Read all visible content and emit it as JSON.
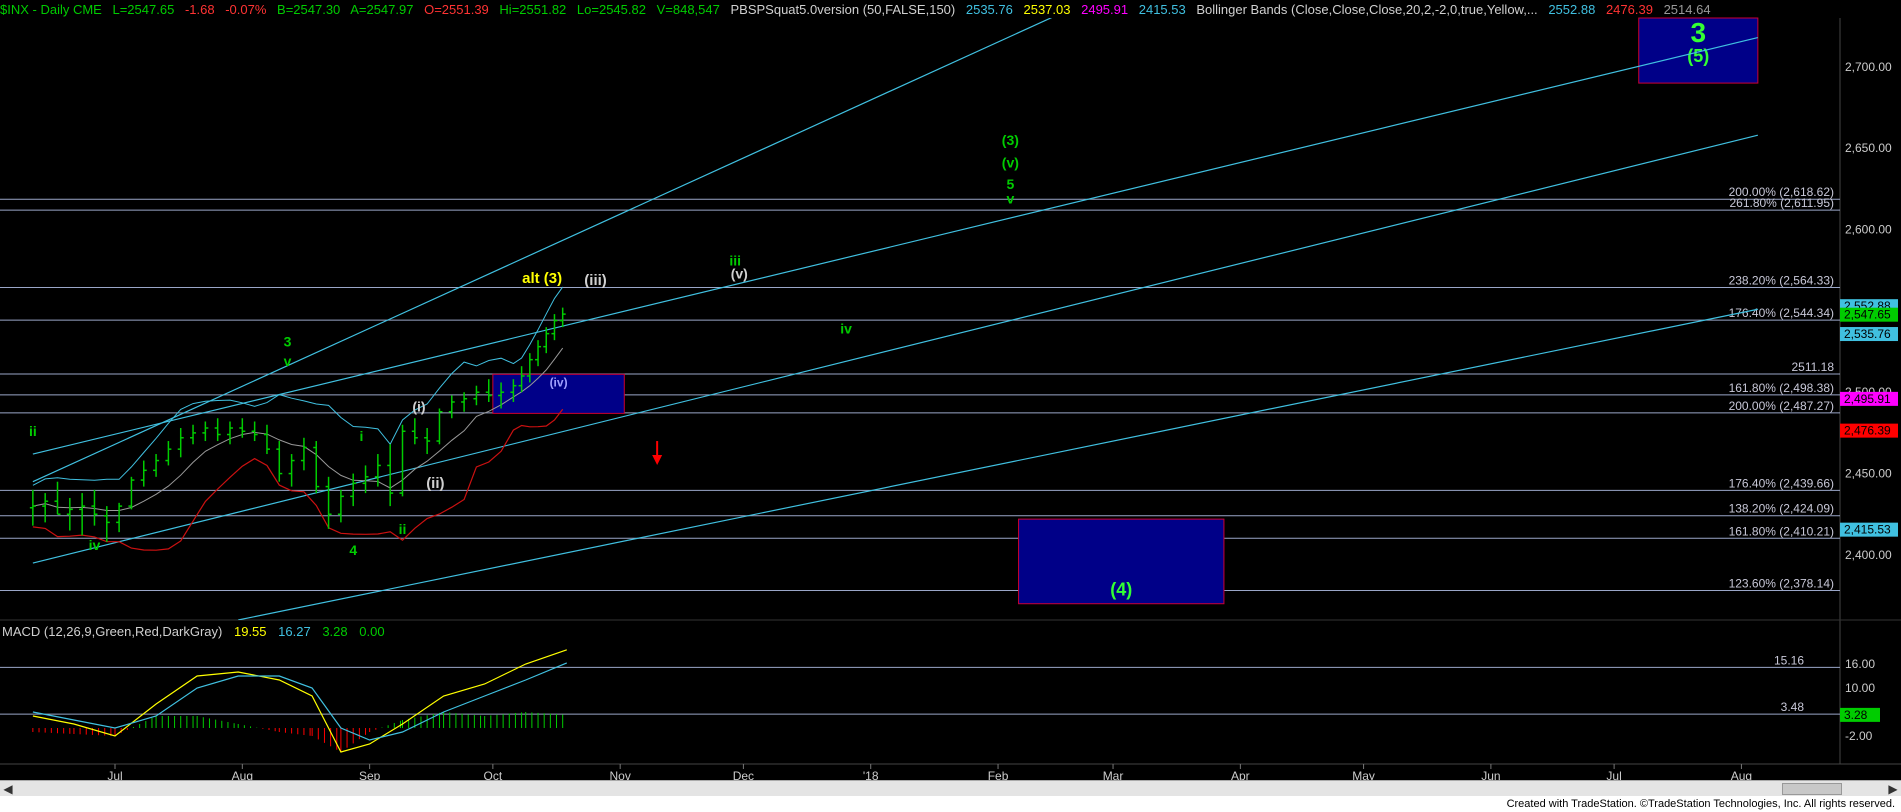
{
  "header": {
    "symbol": "$INX - Daily  CME",
    "last": "L=2547.65",
    "change": "-1.68",
    "change_pct": "-0.07%",
    "bid": "B=2547.30",
    "ask": "A=2547.97",
    "open": "O=2551.39",
    "high": "Hi=2551.82",
    "low": "Lo=2545.82",
    "volume": "V=848,547",
    "study1_name": "PBSPSquat5.0version (50,FALSE,150)",
    "study1_values": [
      "2535.76",
      "2537.03",
      "2495.91",
      "2415.53"
    ],
    "study2_name": "Bollinger Bands (Close,Close,Close,20,2,-2,0,true,Yellow,...",
    "study2_values": [
      "2552.88",
      "2476.39",
      "2514.64"
    ]
  },
  "macd_header": {
    "name": "MACD (12,26,9,Green,Red,DarkGray)",
    "values": [
      "19.55",
      "16.27",
      "3.28",
      "0.00"
    ]
  },
  "colors": {
    "background": "#000000",
    "green": "#00cc00",
    "bright_green": "#33ff33",
    "yellow": "#ffff00",
    "cyan": "#40c0e0",
    "red": "#ff0000",
    "magenta": "#ff00ff",
    "white": "#d0d0d0",
    "navy_box": "#000088"
  },
  "chart_data": {
    "type": "bar",
    "title": "$INX - Daily",
    "price_axis": {
      "range": [
        2360,
        2730
      ],
      "ticks": [
        "2,700.00",
        "2,650.00",
        "2,600.00",
        "2,500.00",
        "2,450.00",
        "2,400.00"
      ],
      "tick_values": [
        2700,
        2650,
        2600,
        2500,
        2450,
        2400
      ]
    },
    "time_axis": {
      "labels": [
        "Jul",
        "Aug",
        "Sep",
        "Oct",
        "Nov",
        "Dec",
        "'18",
        "Feb",
        "Mar",
        "Apr",
        "May",
        "Jun",
        "Jul",
        "Aug"
      ],
      "label_days": [
        20,
        51,
        82,
        112,
        143,
        173,
        204,
        235,
        263,
        294,
        324,
        355,
        385,
        416
      ]
    },
    "ohlc": [
      {
        "d": 0,
        "o": 2429,
        "h": 2440,
        "l": 2418,
        "c": 2430
      },
      {
        "d": 3,
        "o": 2430,
        "h": 2438,
        "l": 2420,
        "c": 2433
      },
      {
        "d": 6,
        "o": 2433,
        "h": 2445,
        "l": 2425,
        "c": 2425
      },
      {
        "d": 9,
        "o": 2425,
        "h": 2435,
        "l": 2415,
        "c": 2428
      },
      {
        "d": 12,
        "o": 2428,
        "h": 2438,
        "l": 2412,
        "c": 2430
      },
      {
        "d": 15,
        "o": 2430,
        "h": 2440,
        "l": 2418,
        "c": 2425
      },
      {
        "d": 18,
        "o": 2424,
        "h": 2430,
        "l": 2408,
        "c": 2420
      },
      {
        "d": 21,
        "o": 2420,
        "h": 2432,
        "l": 2414,
        "c": 2430
      },
      {
        "d": 24,
        "o": 2430,
        "h": 2448,
        "l": 2428,
        "c": 2446
      },
      {
        "d": 27,
        "o": 2446,
        "h": 2458,
        "l": 2442,
        "c": 2452
      },
      {
        "d": 30,
        "o": 2452,
        "h": 2462,
        "l": 2448,
        "c": 2458
      },
      {
        "d": 33,
        "o": 2458,
        "h": 2470,
        "l": 2455,
        "c": 2465
      },
      {
        "d": 36,
        "o": 2465,
        "h": 2478,
        "l": 2460,
        "c": 2472
      },
      {
        "d": 39,
        "o": 2472,
        "h": 2480,
        "l": 2468,
        "c": 2475
      },
      {
        "d": 42,
        "o": 2475,
        "h": 2482,
        "l": 2470,
        "c": 2478
      },
      {
        "d": 45,
        "o": 2478,
        "h": 2484,
        "l": 2470,
        "c": 2474
      },
      {
        "d": 48,
        "o": 2474,
        "h": 2482,
        "l": 2468,
        "c": 2478
      },
      {
        "d": 51,
        "o": 2478,
        "h": 2484,
        "l": 2472,
        "c": 2476
      },
      {
        "d": 54,
        "o": 2476,
        "h": 2482,
        "l": 2470,
        "c": 2474
      },
      {
        "d": 57,
        "o": 2474,
        "h": 2480,
        "l": 2462,
        "c": 2465
      },
      {
        "d": 60,
        "o": 2465,
        "h": 2470,
        "l": 2445,
        "c": 2450
      },
      {
        "d": 63,
        "o": 2450,
        "h": 2462,
        "l": 2442,
        "c": 2458
      },
      {
        "d": 66,
        "o": 2458,
        "h": 2472,
        "l": 2452,
        "c": 2466
      },
      {
        "d": 69,
        "o": 2466,
        "h": 2470,
        "l": 2438,
        "c": 2442
      },
      {
        "d": 72,
        "o": 2442,
        "h": 2448,
        "l": 2416,
        "c": 2425
      },
      {
        "d": 75,
        "o": 2425,
        "h": 2440,
        "l": 2420,
        "c": 2436
      },
      {
        "d": 78,
        "o": 2436,
        "h": 2450,
        "l": 2430,
        "c": 2444
      },
      {
        "d": 81,
        "o": 2444,
        "h": 2455,
        "l": 2438,
        "c": 2448
      },
      {
        "d": 84,
        "o": 2448,
        "h": 2462,
        "l": 2442,
        "c": 2455
      },
      {
        "d": 87,
        "o": 2455,
        "h": 2468,
        "l": 2430,
        "c": 2438
      },
      {
        "d": 90,
        "o": 2438,
        "h": 2480,
        "l": 2436,
        "c": 2476
      },
      {
        "d": 93,
        "o": 2476,
        "h": 2484,
        "l": 2468,
        "c": 2472
      },
      {
        "d": 96,
        "o": 2472,
        "h": 2478,
        "l": 2462,
        "c": 2470
      },
      {
        "d": 99,
        "o": 2470,
        "h": 2490,
        "l": 2468,
        "c": 2488
      },
      {
        "d": 102,
        "o": 2488,
        "h": 2498,
        "l": 2484,
        "c": 2494
      },
      {
        "d": 105,
        "o": 2494,
        "h": 2500,
        "l": 2488,
        "c": 2496
      },
      {
        "d": 108,
        "o": 2496,
        "h": 2504,
        "l": 2492,
        "c": 2500
      },
      {
        "d": 111,
        "o": 2500,
        "h": 2508,
        "l": 2494,
        "c": 2498
      },
      {
        "d": 114,
        "o": 2498,
        "h": 2506,
        "l": 2490,
        "c": 2500
      },
      {
        "d": 117,
        "o": 2500,
        "h": 2508,
        "l": 2494,
        "c": 2504
      },
      {
        "d": 119,
        "o": 2504,
        "h": 2516,
        "l": 2500,
        "c": 2510
      },
      {
        "d": 121,
        "o": 2510,
        "h": 2524,
        "l": 2506,
        "c": 2520
      },
      {
        "d": 123,
        "o": 2520,
        "h": 2532,
        "l": 2516,
        "c": 2528
      },
      {
        "d": 125,
        "o": 2528,
        "h": 2540,
        "l": 2524,
        "c": 2536
      },
      {
        "d": 127,
        "o": 2536,
        "h": 2548,
        "l": 2532,
        "c": 2544
      },
      {
        "d": 129,
        "o": 2544,
        "h": 2552,
        "l": 2540,
        "c": 2548
      }
    ],
    "horizontal_levels": [
      {
        "label": "200.00% (2,618.62)",
        "value": 2618.62
      },
      {
        "label": "261.80% (2,611.95)",
        "value": 2611.95
      },
      {
        "label": "238.20% (2,564.33)",
        "value": 2564.33
      },
      {
        "label": "176.40% (2,544.34)",
        "value": 2544.34
      },
      {
        "label": "2511.18",
        "value": 2511.18
      },
      {
        "label": "161.80% (2,498.38)",
        "value": 2498.38
      },
      {
        "label": "200.00% (2,487.27)",
        "value": 2487.27
      },
      {
        "label": "176.40% (2,439.66)",
        "value": 2439.66
      },
      {
        "label": "138.20% (2,424.09)",
        "value": 2424.09
      },
      {
        "label": "161.80% (2,410.21)",
        "value": 2410.21
      },
      {
        "label": "123.60% (2,378.14)",
        "value": 2378.14
      }
    ],
    "price_markers": [
      {
        "label": "2,552.88",
        "value": 2552.88,
        "bg": "#40c0e0",
        "fg": "#000000"
      },
      {
        "label": "2,547.65",
        "value": 2547.65,
        "bg": "#00cc00",
        "fg": "#000000"
      },
      {
        "label": "2,535.76",
        "value": 2535.76,
        "bg": "#40c0e0",
        "fg": "#000000"
      },
      {
        "label": "2,495.91",
        "value": 2495.91,
        "bg": "#ff00ff",
        "fg": "#000000"
      },
      {
        "label": "2,476.39",
        "value": 2476.39,
        "bg": "#ff0000",
        "fg": "#000000"
      },
      {
        "label": "2,415.53",
        "value": 2415.53,
        "bg": "#40c0e0",
        "fg": "#000000"
      }
    ],
    "channel_lines": [
      {
        "d0": 0,
        "p0": 2445,
        "d1": 300,
        "p1": 2790
      },
      {
        "d0": 0,
        "p0": 2462,
        "d1": 420,
        "p1": 2718
      },
      {
        "d0": 0,
        "p0": 2395,
        "d1": 420,
        "p1": 2658
      },
      {
        "d0": 50,
        "p0": 2360,
        "d1": 420,
        "p1": 2551
      }
    ],
    "boxes": [
      {
        "d0": 391,
        "d1": 420,
        "p0": 2690,
        "p1": 2730,
        "label_top": "3",
        "label_bottom": "(5)"
      },
      {
        "d0": 112,
        "d1": 144,
        "p0": 2487,
        "p1": 2511,
        "label": "(iv)"
      },
      {
        "d0": 240,
        "d1": 290,
        "p0": 2370,
        "p1": 2422,
        "label": "(4)"
      }
    ],
    "wave_labels": [
      {
        "text": "ii",
        "d": 0,
        "p": 2473,
        "color": "green"
      },
      {
        "text": "iv",
        "d": 15,
        "p": 2403,
        "color": "green"
      },
      {
        "text": "3",
        "d": 62,
        "p": 2528,
        "color": "green"
      },
      {
        "text": "v",
        "d": 62,
        "p": 2516,
        "color": "green"
      },
      {
        "text": "i",
        "d": 80,
        "p": 2470,
        "color": "green"
      },
      {
        "text": "4",
        "d": 78,
        "p": 2400,
        "color": "green"
      },
      {
        "text": "ii",
        "d": 90,
        "p": 2413,
        "color": "green"
      },
      {
        "text": "(i)",
        "d": 94,
        "p": 2488,
        "color": "white"
      },
      {
        "text": "(ii)",
        "d": 98,
        "p": 2441,
        "color": "white"
      },
      {
        "text": "(iii)",
        "d": 137,
        "p": 2566,
        "color": "white"
      },
      {
        "text": "alt (3)",
        "d": 124,
        "p": 2567,
        "color": "yellow"
      },
      {
        "text": "iii",
        "d": 171,
        "p": 2578,
        "color": "green"
      },
      {
        "text": "(v)",
        "d": 172,
        "p": 2570,
        "color": "white"
      },
      {
        "text": "iv",
        "d": 198,
        "p": 2536,
        "color": "green"
      },
      {
        "text": "(3)",
        "d": 238,
        "p": 2652,
        "color": "green"
      },
      {
        "text": "(v)",
        "d": 238,
        "p": 2638,
        "color": "green"
      },
      {
        "text": "5",
        "d": 238,
        "p": 2625,
        "color": "green"
      },
      {
        "text": "v",
        "d": 238,
        "p": 2616,
        "color": "green"
      }
    ],
    "arrow": {
      "d": 152,
      "p": 2470,
      "direction": "down",
      "color": "red"
    },
    "macd": {
      "range": [
        -8,
        22
      ],
      "ticks": [
        "16.00",
        "10.00",
        "-2.00"
      ],
      "tick_values": [
        16,
        10,
        -2
      ],
      "levels": [
        {
          "label": "15.16",
          "value": 15.16
        },
        {
          "label": "3.48",
          "value": 3.48
        }
      ],
      "marker": {
        "label": "3.28",
        "value": 3.28
      },
      "macd_line": [
        [
          0,
          3
        ],
        [
          10,
          1
        ],
        [
          20,
          -2
        ],
        [
          30,
          6
        ],
        [
          40,
          13
        ],
        [
          50,
          14
        ],
        [
          60,
          12
        ],
        [
          68,
          8
        ],
        [
          75,
          -6
        ],
        [
          82,
          -4
        ],
        [
          90,
          1
        ],
        [
          100,
          8
        ],
        [
          110,
          11
        ],
        [
          120,
          16
        ],
        [
          130,
          19.55
        ]
      ],
      "signal_line": [
        [
          0,
          4
        ],
        [
          10,
          2
        ],
        [
          20,
          0
        ],
        [
          30,
          3
        ],
        [
          40,
          10
        ],
        [
          50,
          13
        ],
        [
          60,
          13
        ],
        [
          68,
          10
        ],
        [
          75,
          0
        ],
        [
          82,
          -3
        ],
        [
          90,
          -1
        ],
        [
          100,
          4
        ],
        [
          110,
          8
        ],
        [
          120,
          12
        ],
        [
          130,
          16.27
        ]
      ],
      "hist": [
        [
          0,
          -1
        ],
        [
          10,
          -1.5
        ],
        [
          20,
          -2
        ],
        [
          30,
          3
        ],
        [
          40,
          3
        ],
        [
          50,
          1
        ],
        [
          60,
          -1
        ],
        [
          68,
          -2
        ],
        [
          75,
          -6
        ],
        [
          82,
          -1
        ],
        [
          90,
          2
        ],
        [
          100,
          4
        ],
        [
          110,
          3
        ],
        [
          120,
          4
        ],
        [
          130,
          3.28
        ]
      ]
    }
  },
  "footer": {
    "credit": "Created with TradeStation. ©TradeStation Technologies, Inc. All rights reserved."
  }
}
